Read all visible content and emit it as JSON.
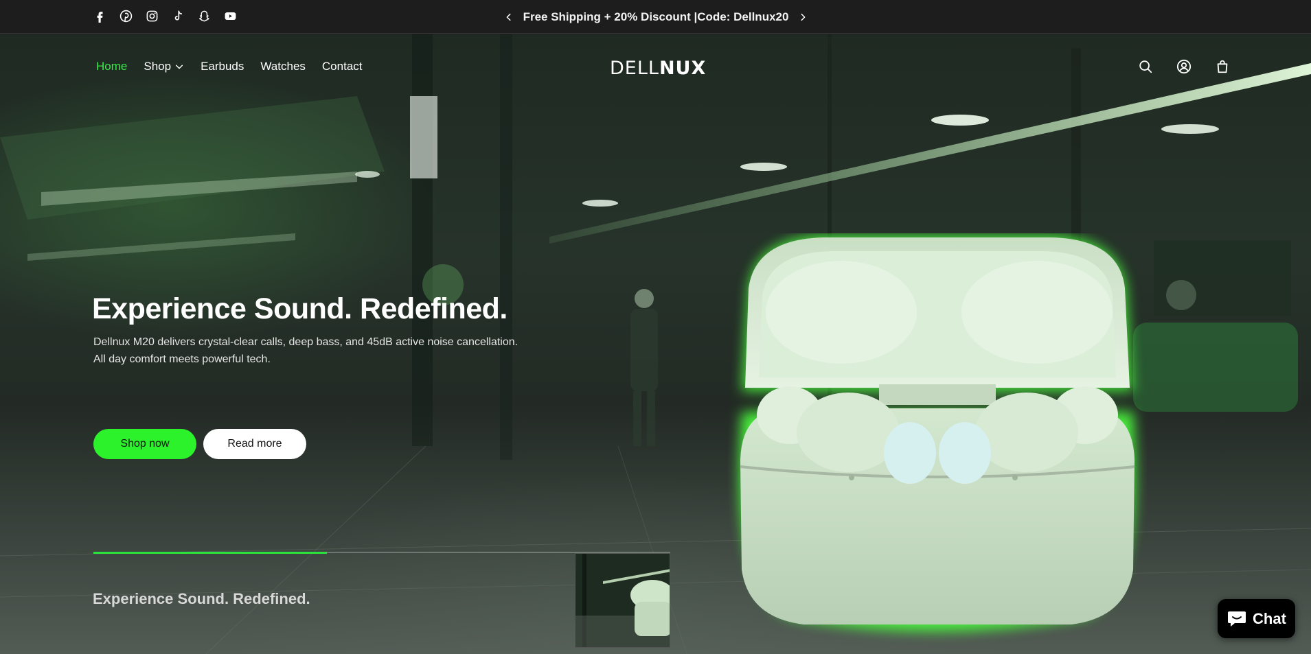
{
  "announcement": {
    "text": "Free Shipping + 20% Discount |Code: Dellnux20",
    "prev_icon": "chevron-left-icon",
    "next_icon": "chevron-right-icon"
  },
  "socials": [
    "facebook-icon",
    "pinterest-icon",
    "instagram-icon",
    "tiktok-icon",
    "snapchat-icon",
    "youtube-icon"
  ],
  "nav": {
    "items": [
      {
        "label": "Home",
        "active": true
      },
      {
        "label": "Shop",
        "dropdown": true
      },
      {
        "label": "Earbuds"
      },
      {
        "label": "Watches"
      },
      {
        "label": "Contact"
      }
    ],
    "logo_light": "DELL",
    "logo_bold": "NUX",
    "icons": [
      "search-icon",
      "account-icon",
      "cart-icon"
    ]
  },
  "hero": {
    "headline": "Experience Sound. Redefined.",
    "subline_1": "Dellnux M20 delivers crystal-clear calls, deep bass, and 45dB active noise cancellation.",
    "subline_2": "All day comfort meets powerful tech.",
    "primary_button": "Shop now",
    "secondary_button": "Read more"
  },
  "slider": {
    "current_title": "Experience Sound. Redefined.",
    "progress": 0.405
  },
  "chat": {
    "label": "Chat"
  },
  "colors": {
    "accent": "#2cf22c",
    "active_link": "#39e94a",
    "bar": "#1d1d1d"
  }
}
